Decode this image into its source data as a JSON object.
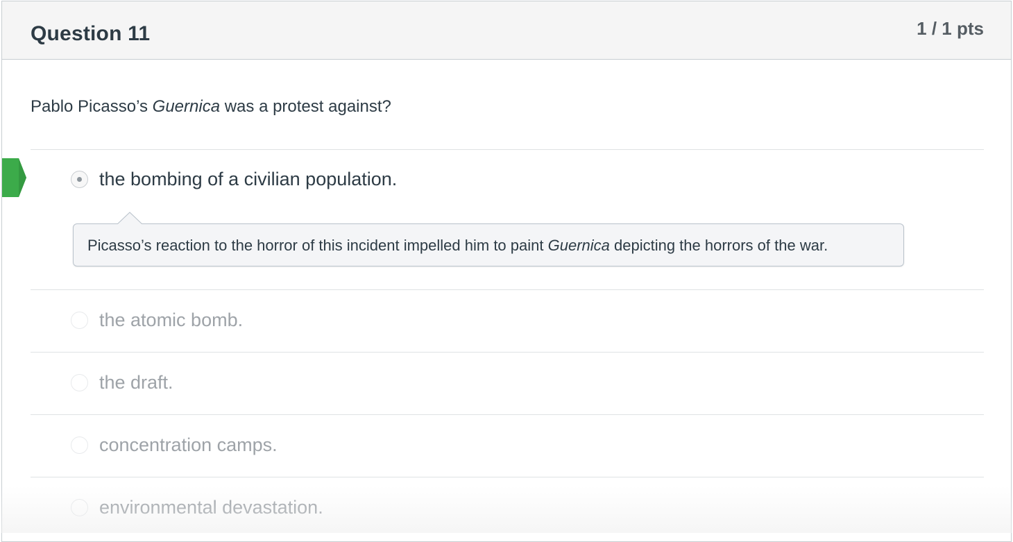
{
  "question": {
    "title": "Question 11",
    "points": "1 / 1 pts",
    "text_before": "Pablo Picasso’s ",
    "text_emphasis": "Guernica",
    "text_after": " was a protest against?"
  },
  "answers": [
    {
      "label": "the bombing of a civilian population.",
      "selected": true,
      "correct": true,
      "comment": {
        "before": "Picasso’s reaction to the horror of this incident impelled him to paint ",
        "emphasis": "Guernica",
        "after": " depicting the horrors of the war."
      }
    },
    {
      "label": "the atomic bomb.",
      "selected": false
    },
    {
      "label": "the draft.",
      "selected": false
    },
    {
      "label": "concentration camps.",
      "selected": false
    },
    {
      "label": "environmental devastation.",
      "selected": false
    }
  ],
  "colors": {
    "correct_flag": "#3cab4a",
    "text": "#2d3b45",
    "muted_text": "#9ea3a8",
    "header_bg": "#f5f5f5",
    "comment_bg": "#f4f5f7"
  },
  "icons": {
    "correct_flag": "correct-answer-flag-icon",
    "radio_selected": "radio-selected-icon",
    "radio_unselected": "radio-unselected-icon"
  }
}
